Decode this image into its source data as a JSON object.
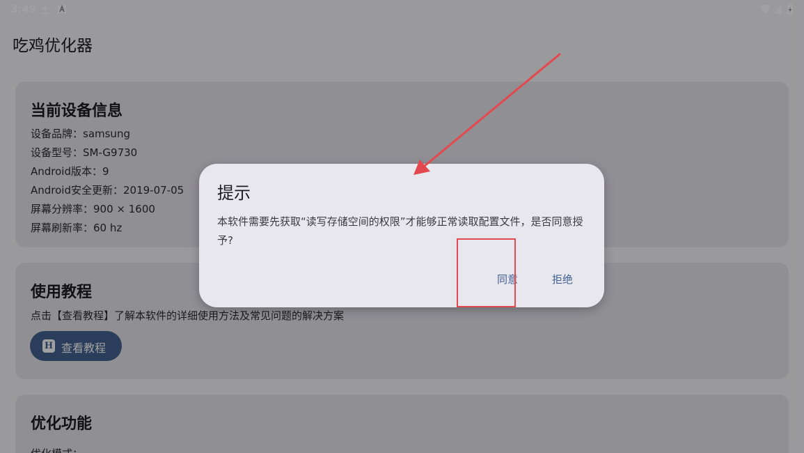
{
  "status_bar": {
    "time": "3:49",
    "left_icons": [
      "download-icon",
      "a-box-icon"
    ],
    "right_icons": [
      "wifi-icon",
      "signal-icon",
      "battery-icon"
    ]
  },
  "app": {
    "title": "吃鸡优化器"
  },
  "device_card": {
    "title": "当前设备信息",
    "lines": [
      "设备品牌：samsung",
      "设备型号：SM-G9730",
      "Android版本：9",
      "Android安全更新：2019-07-05",
      "屏幕分辨率：900 × 1600",
      "屏幕刷新率：60 hz"
    ]
  },
  "tutorial_card": {
    "title": "使用教程",
    "description": "点击【查看教程】了解本软件的详细使用方法及常见问题的解决方案",
    "button_icon_letter": "H",
    "button_label": "查看教程"
  },
  "optimize_card": {
    "title": "优化功能",
    "mode_label": "优化模式："
  },
  "dialog": {
    "title": "提示",
    "message": "本软件需要先获取“读写存储空间的权限”才能够正常读取配置文件，是否同意授予?",
    "agree_label": "同意",
    "reject_label": "拒绝"
  },
  "colors": {
    "accent": "#43618f",
    "dialog_button": "#3f5f90",
    "annotation": "#e4484f",
    "card_bg": "#e4e3ea",
    "page_bg": "#f4f3f8"
  }
}
